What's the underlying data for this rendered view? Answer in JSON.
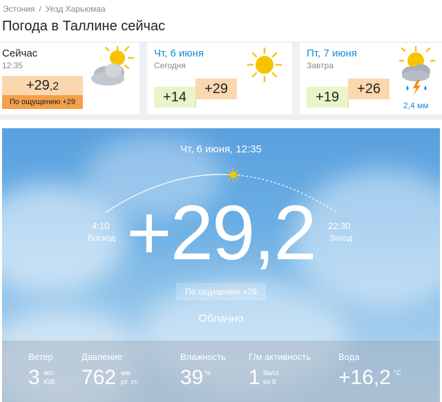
{
  "breadcrumb": {
    "country": "Эстония",
    "separator": "/",
    "region": "Уезд Харьюмаа"
  },
  "page_title": "Погода в Таллине сейчас",
  "now_card": {
    "label": "Сейчас",
    "time": "12:35",
    "temp_main": "+29",
    "temp_dec": ",2",
    "feels": "По ощущению +29",
    "icon": "sun-behind-clouds-icon"
  },
  "days": [
    {
      "title": "Чт, 6 июня",
      "sub": "Сегодня",
      "min": "+14",
      "max": "+29",
      "icon": "sun-icon"
    },
    {
      "title": "Пт, 7 июня",
      "sub": "Завтра",
      "min": "+19",
      "max": "+26",
      "precip": "2,4 мм",
      "icon": "sun-cloud-thunder-rain-icon"
    }
  ],
  "hero": {
    "datetime": "Чт, 6 июня, 12:35",
    "sunrise_time": "4:10",
    "sunrise_label": "Восход",
    "sunset_time": "22:30",
    "sunset_label": "Заход",
    "sun_progress": 0.55,
    "temp": "+29,2",
    "feels": "По ощущению +29",
    "condition": "Облачно"
  },
  "stats": {
    "wind": {
      "label": "Ветер",
      "value": "3",
      "unit1": "м/с",
      "unit2": "ЮВ"
    },
    "pressure": {
      "label": "Давление",
      "value": "762",
      "unit1": "мм",
      "unit2": "рт. ст."
    },
    "humidity": {
      "label": "Влажность",
      "value": "39",
      "unit1": "%"
    },
    "geomagnetic": {
      "label": "Г/м активность",
      "value": "1",
      "unit1": "балл",
      "unit2": "из 8"
    },
    "water": {
      "label": "Вода",
      "value": "+16,2",
      "unit1": "°C"
    }
  },
  "colors": {
    "accent": "#1a8ad8",
    "warm": "#fbd7b0",
    "warm_strong": "#f2a04a",
    "cool": "#e8f5c8"
  }
}
